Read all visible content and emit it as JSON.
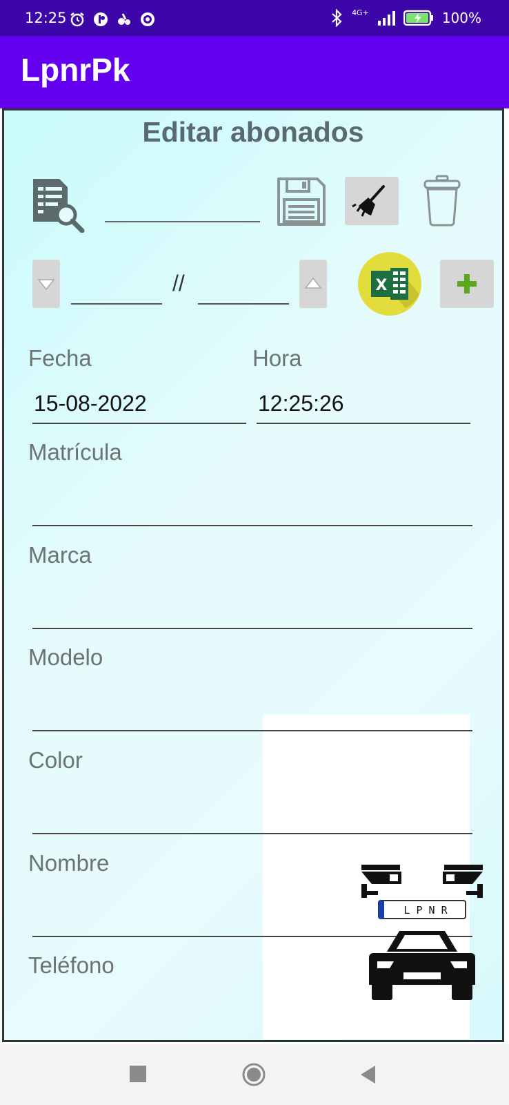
{
  "status_bar": {
    "time": "12:25",
    "network": "4G+",
    "battery": "100%"
  },
  "app_bar": {
    "title": "LpnrPk"
  },
  "page": {
    "title": "Editar abonados",
    "search_value": "",
    "nav_separator": "//",
    "nav_from": "",
    "nav_to": ""
  },
  "form": {
    "fecha": {
      "label": "Fecha",
      "value": "15-08-2022"
    },
    "hora": {
      "label": "Hora",
      "value": "12:25:26"
    },
    "matricula": {
      "label": "Matrícula",
      "value": ""
    },
    "marca": {
      "label": "Marca",
      "value": ""
    },
    "modelo": {
      "label": "Modelo",
      "value": ""
    },
    "color": {
      "label": "Color",
      "value": ""
    },
    "nombre": {
      "label": "Nombre",
      "value": ""
    },
    "telefono": {
      "label": "Teléfono",
      "value": ""
    }
  },
  "logo": {
    "plate_text": "L P N R"
  },
  "colors": {
    "status_bar": "#3c06a8",
    "app_bar": "#6200ee",
    "excel_green": "#1d6f42",
    "add_green": "#5aa81c"
  }
}
